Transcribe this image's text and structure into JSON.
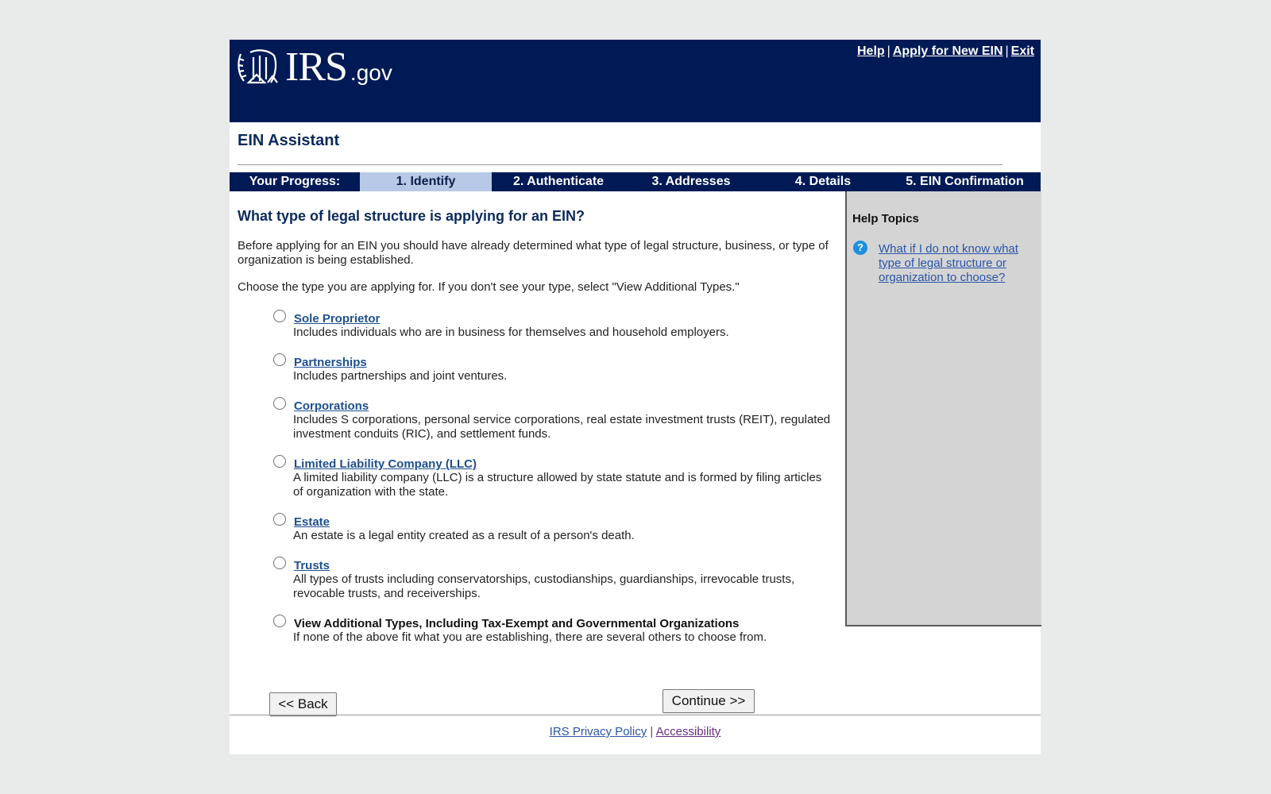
{
  "header": {
    "logo_main": "IRS",
    "logo_suffix": ".gov",
    "links": {
      "help": "Help",
      "apply": "Apply for New EIN",
      "exit": "Exit",
      "separator": "|"
    }
  },
  "app_title": "EIN Assistant",
  "progress": {
    "label": "Your Progress:",
    "steps": [
      {
        "label": "1. Identify",
        "active": true
      },
      {
        "label": "2. Authenticate",
        "active": false
      },
      {
        "label": "3. Addresses",
        "active": false
      },
      {
        "label": "4. Details",
        "active": false
      },
      {
        "label": "5. EIN Confirmation",
        "active": false
      }
    ]
  },
  "main": {
    "question": "What type of legal structure is applying for an EIN?",
    "intro": "Before applying for an EIN you should have already determined what type of legal structure, business, or type of organization is being established.",
    "instruction": "Choose the type you are applying for. If you don't see your type, select \"View Additional Types.\"",
    "options": [
      {
        "label": "Sole Proprietor",
        "description": "Includes individuals who are in business for themselves and household employers.",
        "selected": false
      },
      {
        "label": "Partnerships",
        "description": "Includes partnerships and joint ventures.",
        "selected": false
      },
      {
        "label": "Corporations",
        "description": "Includes S corporations, personal service corporations, real estate investment trusts (REIT), regulated investment conduits (RIC), and settlement funds.",
        "selected": false
      },
      {
        "label": "Limited Liability Company (LLC)",
        "description": "A limited liability company (LLC) is a structure allowed by state statute and is formed by filing articles of organization with the state.",
        "selected": false
      },
      {
        "label": "Estate",
        "description": "An estate is a legal entity created as a result of a person's death.",
        "selected": false
      },
      {
        "label": "Trusts",
        "description": "All types of trusts including conservatorships, custodianships, guardianships, irrevocable trusts, revocable trusts, and receiverships.",
        "selected": false
      },
      {
        "label": "View Additional Types, Including Tax-Exempt and Governmental Organizations",
        "description": "If none of the above fit what you are establishing, there are several others to choose from.",
        "selected": false
      }
    ]
  },
  "sidebar": {
    "title": "Help Topics",
    "icon": "question-circle-icon",
    "link": "What if I do not know what type of legal structure or organization to choose?"
  },
  "buttons": {
    "back": "<< Back",
    "continue": "Continue >>"
  },
  "footer": {
    "privacy": "IRS Privacy Policy",
    "separator": "|",
    "accessibility": "Accessibility"
  },
  "colors": {
    "header_bg": "#001a56",
    "active_step_bg": "#b7c9e6",
    "heading": "#0b2a5c",
    "link": "#1d4f91",
    "sidebar_bg": "#d4d4d4",
    "help_icon": "#1b8fe0"
  }
}
